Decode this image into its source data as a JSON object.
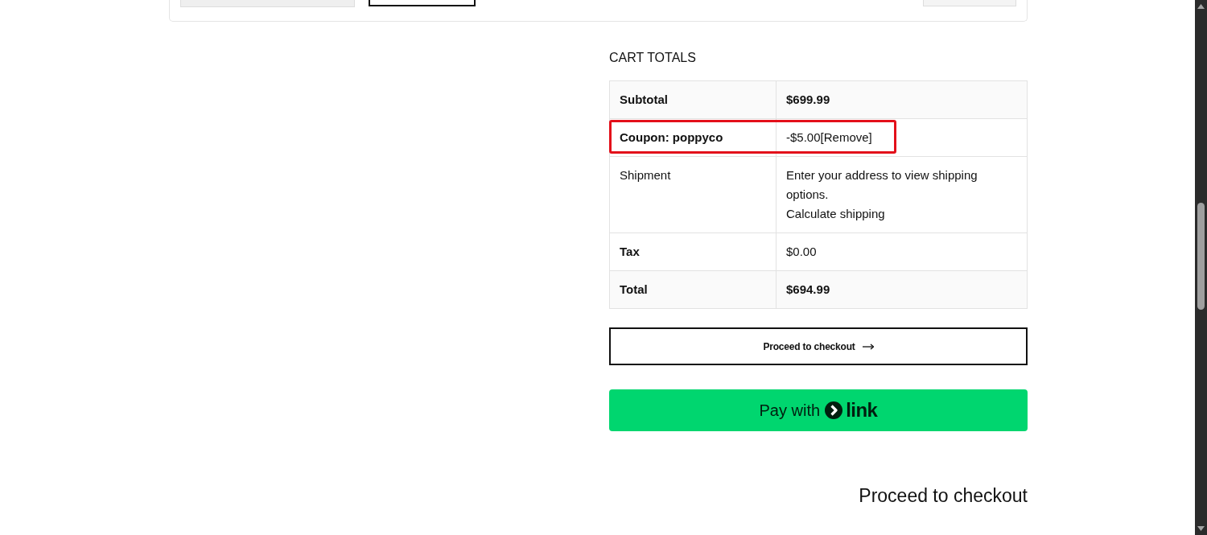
{
  "cart_totals": {
    "title": "CART TOTALS",
    "rows": [
      {
        "kind": "total",
        "label": "Subtotal",
        "value": "$699.99",
        "highlighted": false
      },
      {
        "kind": "line",
        "label": "Coupon: poppyco",
        "value": "-$5.00",
        "link": "[Remove]",
        "highlighted": true
      },
      {
        "kind": "info",
        "label": "Shipment",
        "value": "Enter your address to view shipping options.",
        "link": "Calculate shipping",
        "highlighted": false
      },
      {
        "kind": "line",
        "label": "Tax",
        "value": "$0.00",
        "highlighted": false
      },
      {
        "kind": "total",
        "label": "Total",
        "value": "$694.99",
        "highlighted": false
      }
    ]
  },
  "checkout_button": {
    "label": "Proceed to checkout"
  },
  "link_button": {
    "label": "Pay with",
    "logo_text": "link"
  },
  "footer_heading": "Proceed to checkout"
}
